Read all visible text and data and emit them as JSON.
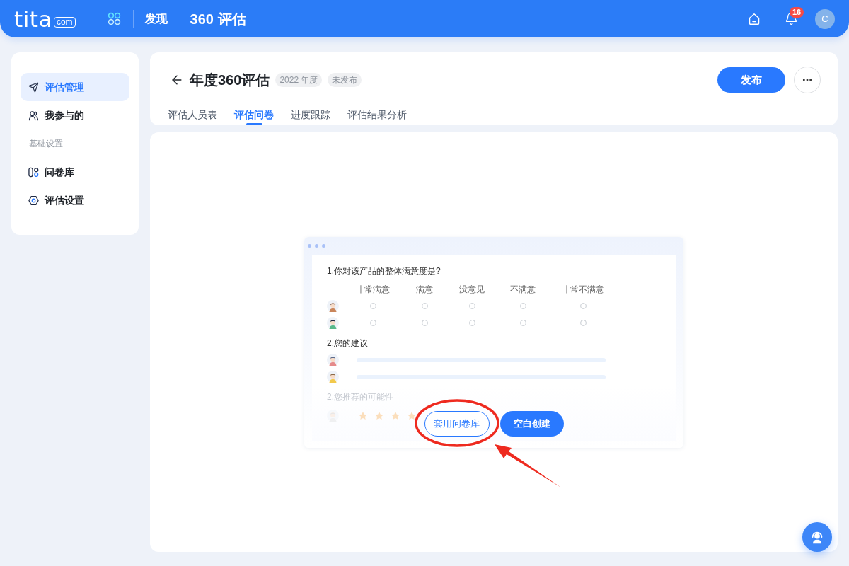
{
  "top_bar": {
    "logo": {
      "wordmark": "tita",
      "suffix": "com"
    },
    "nav_link": "发现",
    "app_title": "360 评估",
    "notification_count": "16",
    "avatar_initial": "C"
  },
  "sidebar": {
    "items": [
      {
        "kind": "link",
        "label": "评估管理",
        "selected": true
      },
      {
        "kind": "link",
        "label": "我参与的",
        "selected": false
      },
      {
        "kind": "section",
        "label": "基础设置"
      },
      {
        "kind": "link",
        "label": "问卷库",
        "selected": false
      },
      {
        "kind": "link",
        "label": "评估设置",
        "selected": false
      }
    ]
  },
  "page_header": {
    "title": "年度360评估",
    "tags": [
      "2022 年度",
      "未发布"
    ],
    "publish_button": "发布",
    "tabs": [
      {
        "label": "评估人员表",
        "selected": false
      },
      {
        "label": "评估问卷",
        "selected": true
      },
      {
        "label": "进度跟踪",
        "selected": false
      },
      {
        "label": "评估结果分析",
        "selected": false
      }
    ]
  },
  "empty_state": {
    "preview": {
      "questions": [
        {
          "title": "1.你对该产品的整体满意度是?",
          "dimmed": false,
          "columns": [
            "非常满意",
            "满意",
            "没意见",
            "不满意",
            "非常不满意"
          ],
          "rows": [
            {
              "kind": "choice",
              "options": [
                {
                  "selected": false
                },
                {
                  "selected": false
                },
                {
                  "selected": false
                },
                {
                  "selected": false
                },
                {
                  "selected": false
                }
              ]
            },
            {
              "kind": "choice",
              "options": [
                {
                  "selected": false
                },
                {
                  "selected": false
                },
                {
                  "selected": false
                },
                {
                  "selected": false
                },
                {
                  "selected": false
                }
              ]
            }
          ]
        },
        {
          "title": "2.您的建议",
          "dimmed": false,
          "rows": [
            {
              "kind": "text"
            },
            {
              "kind": "text"
            }
          ]
        },
        {
          "title": "2.您推荐的可能性",
          "dimmed": true,
          "rows": [
            {
              "kind": "rating",
              "stars": 4
            }
          ]
        }
      ]
    },
    "buttons": [
      {
        "kind": "outline",
        "label": "套用问卷库"
      },
      {
        "kind": "primary",
        "label": "空白创建"
      }
    ]
  }
}
